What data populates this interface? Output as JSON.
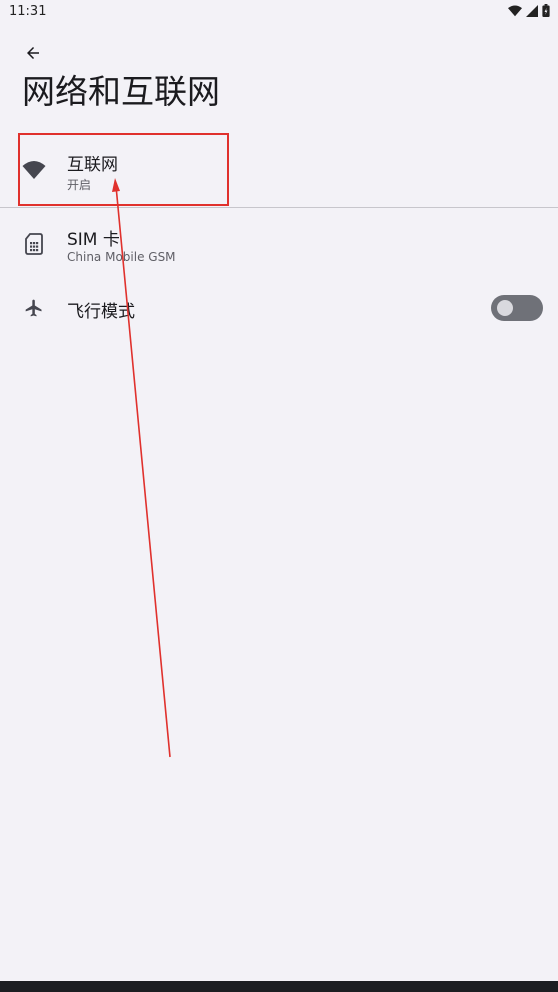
{
  "status_bar": {
    "time": "11:31",
    "icons": [
      "wifi-icon",
      "signal-icon",
      "battery-icon"
    ]
  },
  "toolbar": {
    "back_icon": "back-arrow-icon"
  },
  "page": {
    "title": "网络和互联网"
  },
  "items": [
    {
      "icon": "wifi-icon",
      "title": "互联网",
      "subtitle": "开启"
    },
    {
      "icon": "sim-card-icon",
      "title": "SIM 卡",
      "subtitle": "China Mobile GSM"
    },
    {
      "icon": "airplane-icon",
      "title": "飞行模式",
      "toggle_on": false
    }
  ],
  "colors": {
    "background": "#f3f2f7",
    "annotation": "#e0312d",
    "toggle_off_track": "#6f7178"
  }
}
